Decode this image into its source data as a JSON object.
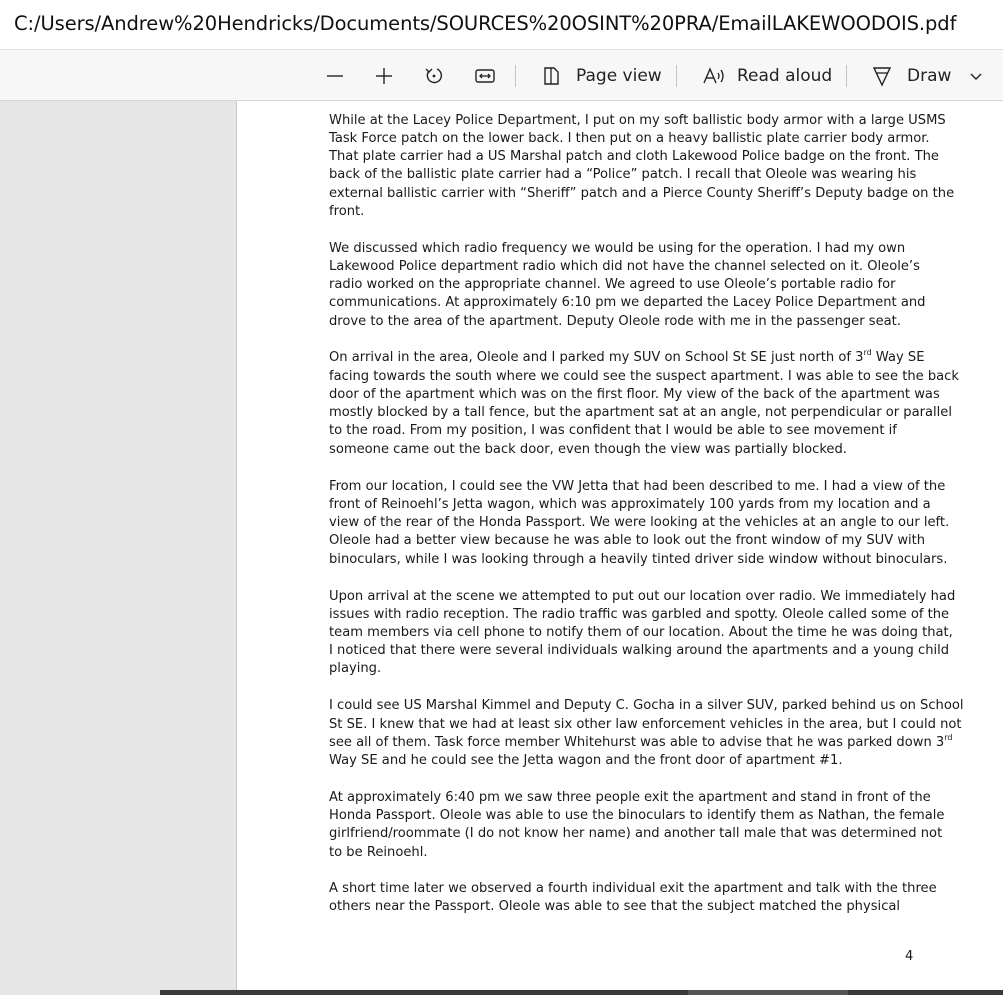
{
  "address": {
    "url": "C:/Users/Andrew%20Hendricks/Documents/SOURCES%20OSINT%20PRA/EmailLAKEWOODOIS.pdf"
  },
  "toolbar": {
    "page_view_label": "Page view",
    "read_aloud_label": "Read aloud",
    "draw_label": "Draw",
    "icons": [
      "minus-icon",
      "plus-icon",
      "rotate-icon",
      "fit-width-icon",
      "page-view-icon",
      "read-aloud-icon",
      "draw-icon",
      "chevron-down-icon"
    ]
  },
  "document": {
    "lines": [
      "While at the Lacey Police Department, I put on my soft ballistic body armor with a large USMS",
      "Task Force patch on the lower back.  I then put on a heavy ballistic plate carrier body armor.",
      "That plate carrier had a US Marshal patch and cloth Lakewood Police badge on the front. The",
      "back of the ballistic plate carrier had a “Police” patch.  I recall that Oleole was wearing his",
      "external ballistic carrier with “Sheriff” patch and a Pierce County Sheriff’s Deputy badge on the",
      "front.",
      "We discussed which radio frequency we would be using for the operation.  I had my own",
      "Lakewood Police department radio which did not have the channel selected on it.  Oleole’s",
      "radio worked on the appropriate channel.  We agreed to use Oleole’s portable radio for",
      "communications. At approximately 6:10 pm we departed the Lacey Police Department and",
      "drove to the area of the apartment.  Deputy Oleole rode with me in the passenger seat.",
      "On arrival in the area, Oleole and I parked my SUV on School St SE just north of 3",
      "facing towards the south where we could see the suspect apartment. I was able to see the back",
      "door of the apartment which was on the first floor. My view of the back of the apartment was",
      "mostly blocked by a tall fence, but the apartment sat at an angle, not perpendicular or parallel",
      "to the road.  From my position, I was confident that I would be able to see movement if",
      "someone came out the back door, even though the view was partially blocked.",
      "From our location, I could see the VW Jetta that had been described to me.  I had a view of the",
      "front of Reinoehl’s Jetta wagon, which was approximately 100 yards from my location and a",
      "view of the rear of the Honda Passport. We were looking at the vehicles at an angle to our left.",
      "Oleole had a better view because he was able to look out the front window of my SUV with",
      "binoculars, while I was looking through a heavily tinted driver side window without binoculars.",
      "Upon arrival at the scene we attempted to put out our location over radio. We immediately had",
      "issues with radio reception. The radio traffic was garbled and spotty. Oleole called some of the",
      "team members via cell phone to notify them of our location. About the time he was doing that,",
      "I noticed that there were several individuals walking around the apartments and a young child",
      "playing.",
      "I could see US Marshal Kimmel and Deputy C. Gocha in a silver SUV, parked behind us on School",
      "St SE. I knew that we had at least six other law enforcement vehicles in the area, but I could not",
      "see all of them. Task force member Whitehurst was able to advise that he was parked down 3",
      "Way SE and he could see the Jetta wagon and the front door of apartment #1.",
      "At approximately 6:40 pm we saw three people exit the apartment and stand in front of the",
      "Honda Passport. Oleole was able to use the binoculars to identify them as Nathan, the female",
      "girlfriend/roommate (I do not know her name) and another tall male that was determined not",
      "to be Reinoehl.",
      "A short time later we observed a fourth individual exit the apartment and talk with the three",
      "others near the Passport. Oleole was able to see that the subject matched the physical"
    ],
    "line_11_sup": "rd",
    "line_11_tail": " Way SE",
    "line_29_sup": "rd",
    "page_number": "4"
  }
}
